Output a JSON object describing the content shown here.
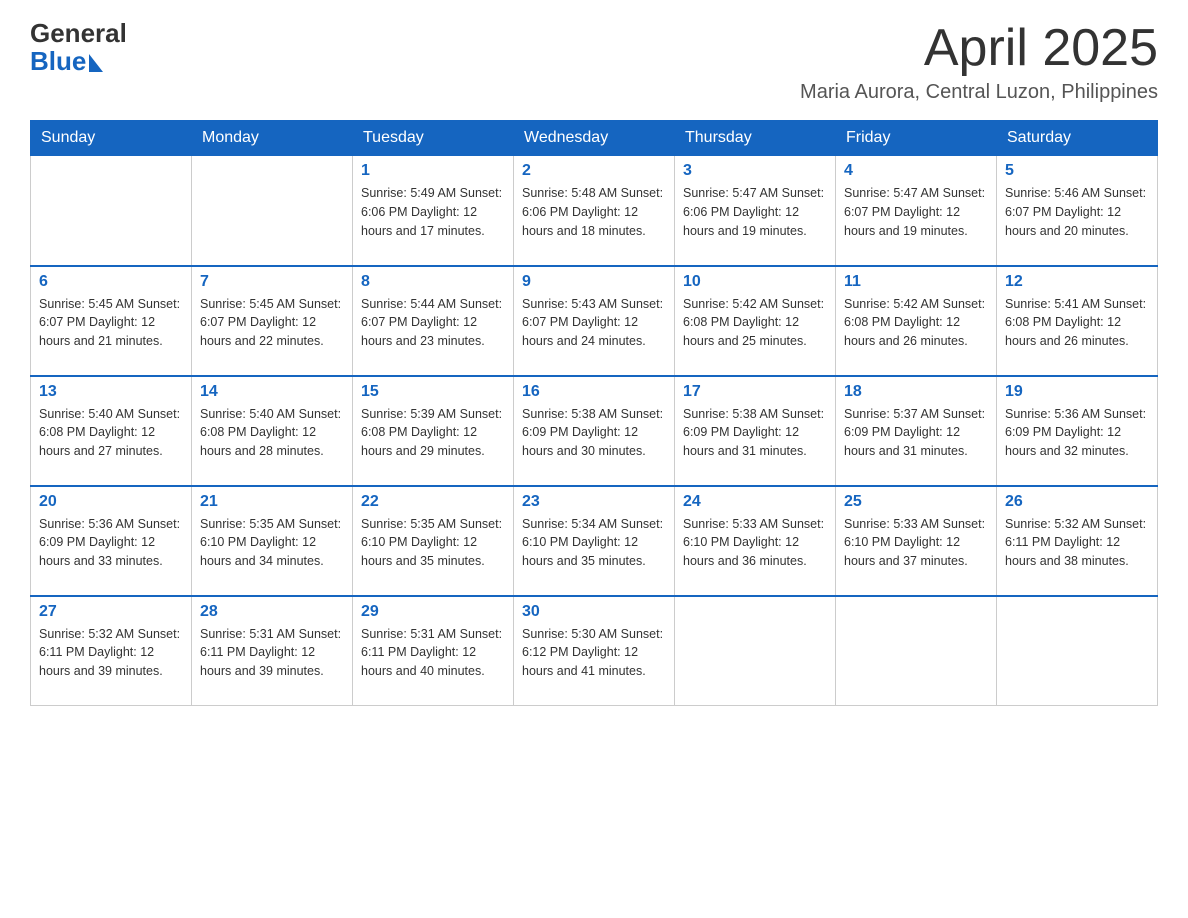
{
  "header": {
    "logo_general": "General",
    "logo_blue": "Blue",
    "month_title": "April 2025",
    "location": "Maria Aurora, Central Luzon, Philippines"
  },
  "calendar": {
    "days_of_week": [
      "Sunday",
      "Monday",
      "Tuesday",
      "Wednesday",
      "Thursday",
      "Friday",
      "Saturday"
    ],
    "weeks": [
      [
        {
          "day": "",
          "info": ""
        },
        {
          "day": "",
          "info": ""
        },
        {
          "day": "1",
          "info": "Sunrise: 5:49 AM\nSunset: 6:06 PM\nDaylight: 12 hours\nand 17 minutes."
        },
        {
          "day": "2",
          "info": "Sunrise: 5:48 AM\nSunset: 6:06 PM\nDaylight: 12 hours\nand 18 minutes."
        },
        {
          "day": "3",
          "info": "Sunrise: 5:47 AM\nSunset: 6:06 PM\nDaylight: 12 hours\nand 19 minutes."
        },
        {
          "day": "4",
          "info": "Sunrise: 5:47 AM\nSunset: 6:07 PM\nDaylight: 12 hours\nand 19 minutes."
        },
        {
          "day": "5",
          "info": "Sunrise: 5:46 AM\nSunset: 6:07 PM\nDaylight: 12 hours\nand 20 minutes."
        }
      ],
      [
        {
          "day": "6",
          "info": "Sunrise: 5:45 AM\nSunset: 6:07 PM\nDaylight: 12 hours\nand 21 minutes."
        },
        {
          "day": "7",
          "info": "Sunrise: 5:45 AM\nSunset: 6:07 PM\nDaylight: 12 hours\nand 22 minutes."
        },
        {
          "day": "8",
          "info": "Sunrise: 5:44 AM\nSunset: 6:07 PM\nDaylight: 12 hours\nand 23 minutes."
        },
        {
          "day": "9",
          "info": "Sunrise: 5:43 AM\nSunset: 6:07 PM\nDaylight: 12 hours\nand 24 minutes."
        },
        {
          "day": "10",
          "info": "Sunrise: 5:42 AM\nSunset: 6:08 PM\nDaylight: 12 hours\nand 25 minutes."
        },
        {
          "day": "11",
          "info": "Sunrise: 5:42 AM\nSunset: 6:08 PM\nDaylight: 12 hours\nand 26 minutes."
        },
        {
          "day": "12",
          "info": "Sunrise: 5:41 AM\nSunset: 6:08 PM\nDaylight: 12 hours\nand 26 minutes."
        }
      ],
      [
        {
          "day": "13",
          "info": "Sunrise: 5:40 AM\nSunset: 6:08 PM\nDaylight: 12 hours\nand 27 minutes."
        },
        {
          "day": "14",
          "info": "Sunrise: 5:40 AM\nSunset: 6:08 PM\nDaylight: 12 hours\nand 28 minutes."
        },
        {
          "day": "15",
          "info": "Sunrise: 5:39 AM\nSunset: 6:08 PM\nDaylight: 12 hours\nand 29 minutes."
        },
        {
          "day": "16",
          "info": "Sunrise: 5:38 AM\nSunset: 6:09 PM\nDaylight: 12 hours\nand 30 minutes."
        },
        {
          "day": "17",
          "info": "Sunrise: 5:38 AM\nSunset: 6:09 PM\nDaylight: 12 hours\nand 31 minutes."
        },
        {
          "day": "18",
          "info": "Sunrise: 5:37 AM\nSunset: 6:09 PM\nDaylight: 12 hours\nand 31 minutes."
        },
        {
          "day": "19",
          "info": "Sunrise: 5:36 AM\nSunset: 6:09 PM\nDaylight: 12 hours\nand 32 minutes."
        }
      ],
      [
        {
          "day": "20",
          "info": "Sunrise: 5:36 AM\nSunset: 6:09 PM\nDaylight: 12 hours\nand 33 minutes."
        },
        {
          "day": "21",
          "info": "Sunrise: 5:35 AM\nSunset: 6:10 PM\nDaylight: 12 hours\nand 34 minutes."
        },
        {
          "day": "22",
          "info": "Sunrise: 5:35 AM\nSunset: 6:10 PM\nDaylight: 12 hours\nand 35 minutes."
        },
        {
          "day": "23",
          "info": "Sunrise: 5:34 AM\nSunset: 6:10 PM\nDaylight: 12 hours\nand 35 minutes."
        },
        {
          "day": "24",
          "info": "Sunrise: 5:33 AM\nSunset: 6:10 PM\nDaylight: 12 hours\nand 36 minutes."
        },
        {
          "day": "25",
          "info": "Sunrise: 5:33 AM\nSunset: 6:10 PM\nDaylight: 12 hours\nand 37 minutes."
        },
        {
          "day": "26",
          "info": "Sunrise: 5:32 AM\nSunset: 6:11 PM\nDaylight: 12 hours\nand 38 minutes."
        }
      ],
      [
        {
          "day": "27",
          "info": "Sunrise: 5:32 AM\nSunset: 6:11 PM\nDaylight: 12 hours\nand 39 minutes."
        },
        {
          "day": "28",
          "info": "Sunrise: 5:31 AM\nSunset: 6:11 PM\nDaylight: 12 hours\nand 39 minutes."
        },
        {
          "day": "29",
          "info": "Sunrise: 5:31 AM\nSunset: 6:11 PM\nDaylight: 12 hours\nand 40 minutes."
        },
        {
          "day": "30",
          "info": "Sunrise: 5:30 AM\nSunset: 6:12 PM\nDaylight: 12 hours\nand 41 minutes."
        },
        {
          "day": "",
          "info": ""
        },
        {
          "day": "",
          "info": ""
        },
        {
          "day": "",
          "info": ""
        }
      ]
    ]
  }
}
